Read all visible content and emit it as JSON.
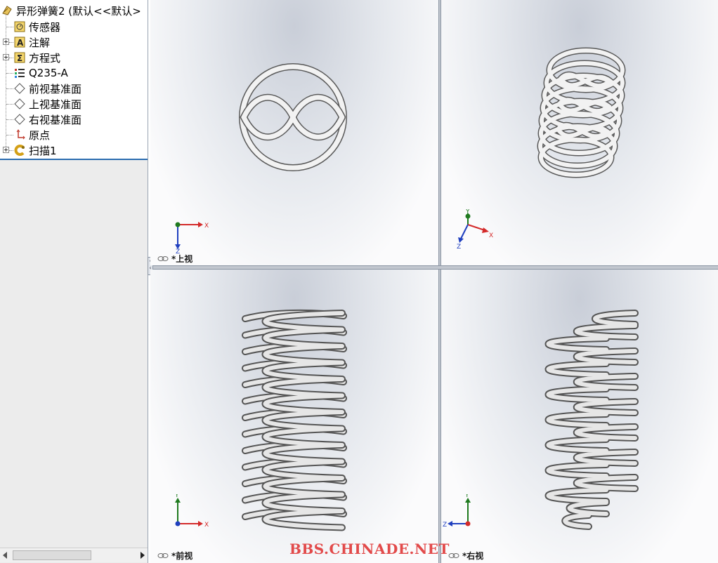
{
  "feature_tree": {
    "root": {
      "label": "异形弹簧2 (默认<<默认>",
      "icon": "part-icon"
    },
    "items": [
      {
        "label": "传感器",
        "icon": "sensor-icon",
        "expandable": false
      },
      {
        "label": "注解",
        "icon": "annotation-icon",
        "expandable": true
      },
      {
        "label": "方程式",
        "icon": "equation-icon",
        "expandable": true
      },
      {
        "label": "Q235-A",
        "icon": "material-icon",
        "expandable": false
      },
      {
        "label": "前视基准面",
        "icon": "plane-icon",
        "expandable": false
      },
      {
        "label": "上视基准面",
        "icon": "plane-icon",
        "expandable": false
      },
      {
        "label": "右视基准面",
        "icon": "plane-icon",
        "expandable": false
      },
      {
        "label": "原点",
        "icon": "origin-icon",
        "expandable": false
      },
      {
        "label": "扫描1",
        "icon": "sweep-icon",
        "expandable": true
      }
    ]
  },
  "viewports": {
    "top": {
      "label": "*上视",
      "axes": [
        "X",
        "Z"
      ]
    },
    "iso": {
      "label": "",
      "axes": [
        "Y",
        "X",
        "Z"
      ]
    },
    "front": {
      "label": "*前视",
      "axes": [
        "Y",
        "X"
      ]
    },
    "right": {
      "label": "*右视",
      "axes": [
        "Y",
        "Z"
      ]
    }
  },
  "watermark": "BBS.CHINADE.NET",
  "colors": {
    "axis_x": "#d42a2a",
    "axis_y": "#1f7a1f",
    "axis_z": "#1f3fbf",
    "accent": "#2b6cb0",
    "spring": "#9a9a9a"
  }
}
